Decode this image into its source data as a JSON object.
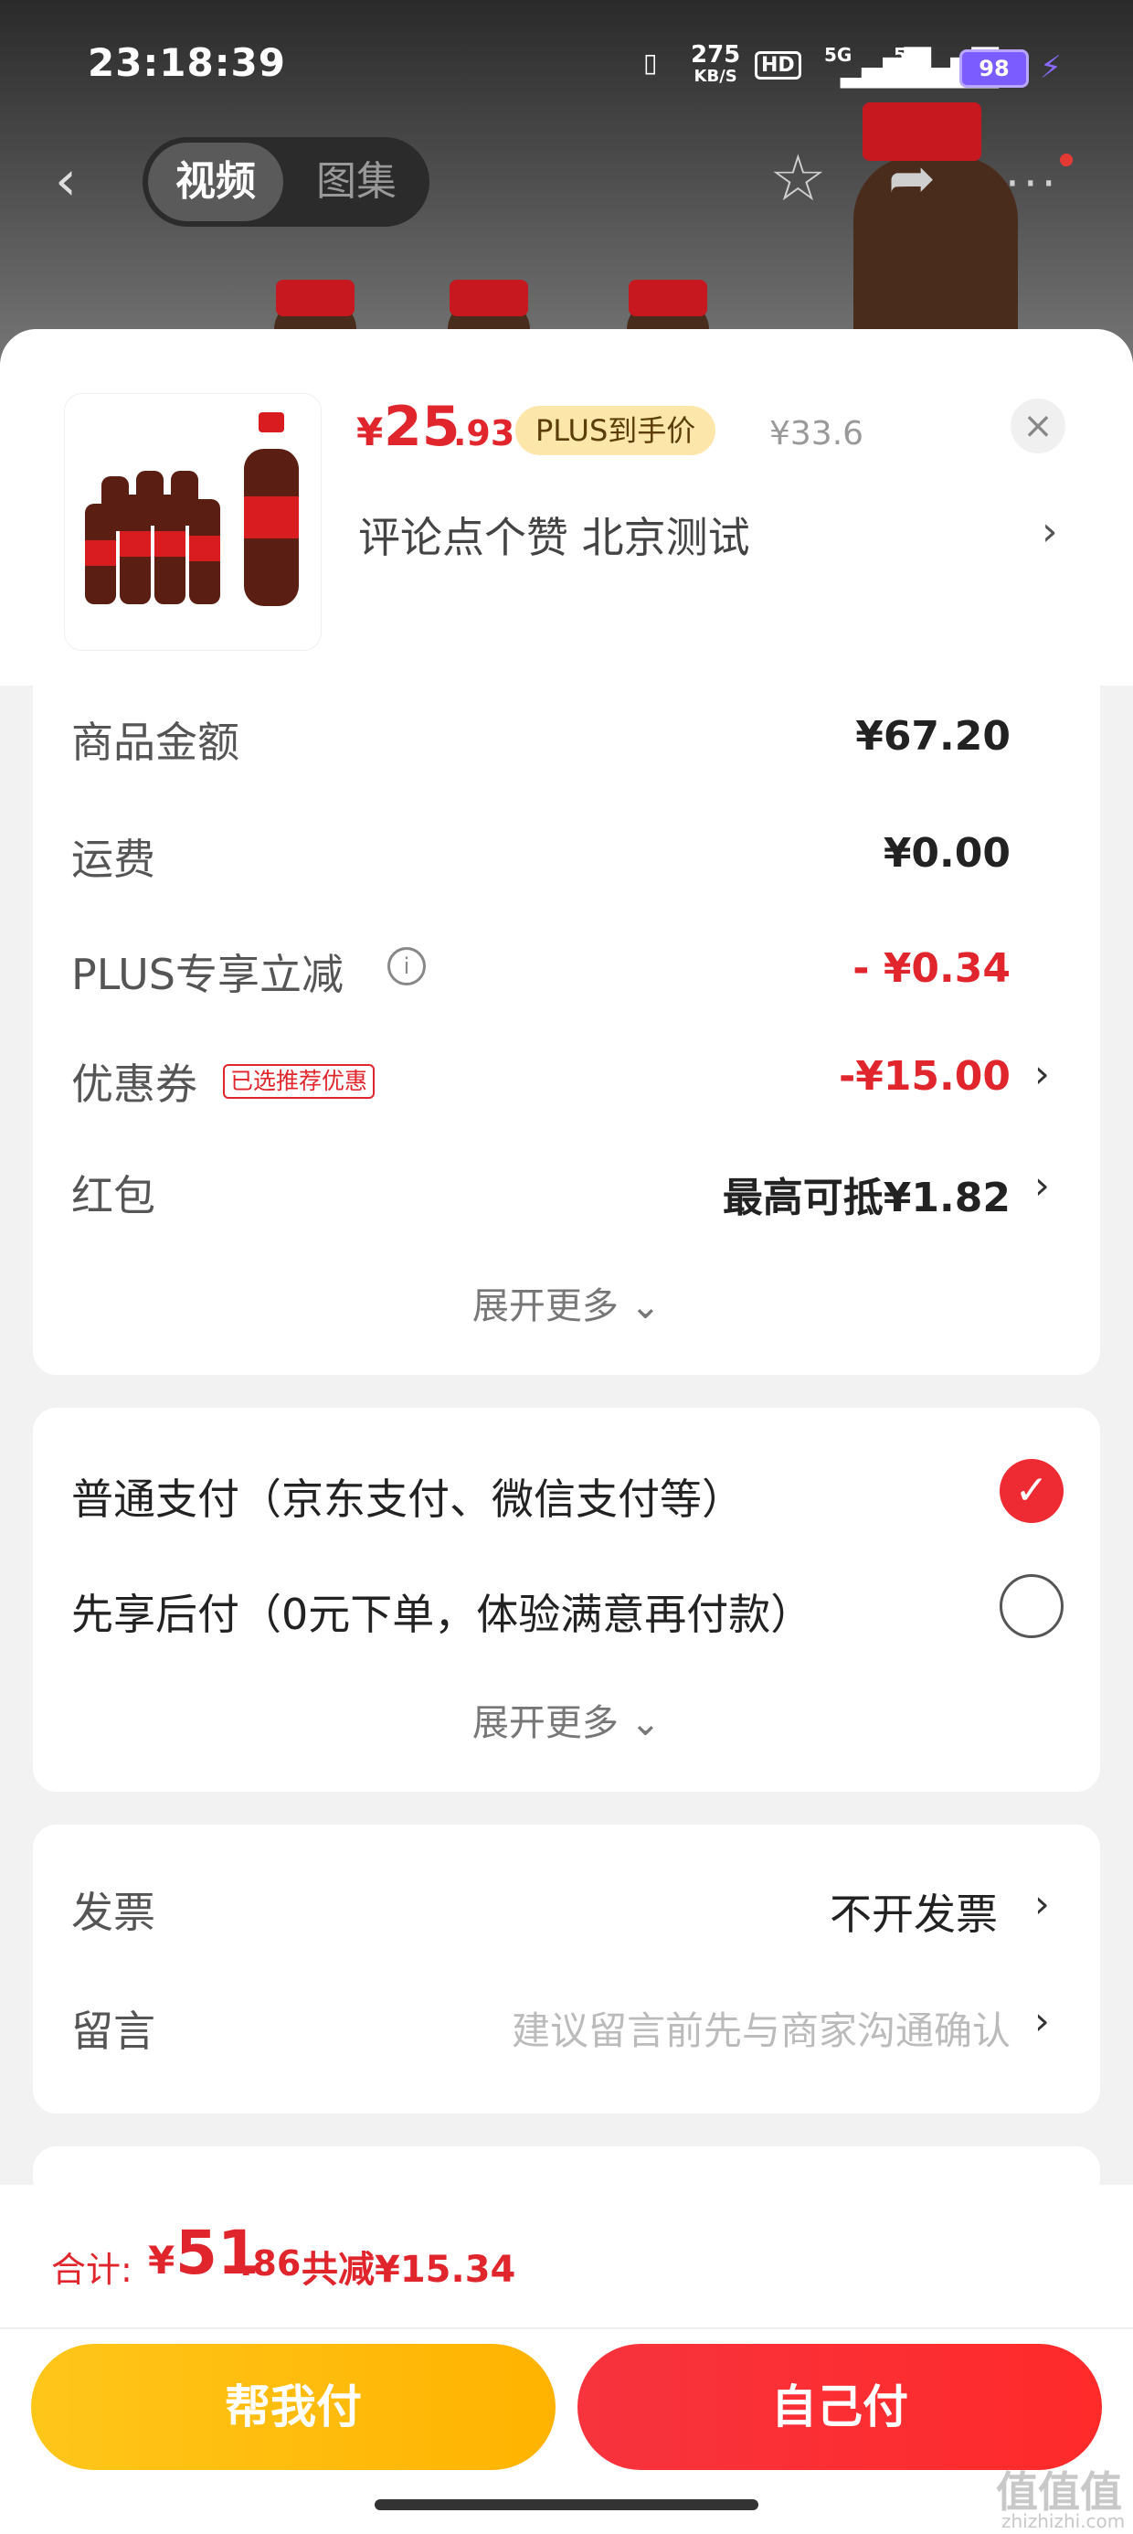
{
  "status_bar": {
    "time": "23:18:39",
    "net_speed_value": "275",
    "net_speed_unit": "KB/S",
    "hd": "HD",
    "signal1": "5G",
    "signal2": "5G",
    "battery": "98",
    "icons": [
      "vibrate-icon",
      "hd-icon",
      "signal-icon",
      "signal-icon",
      "battery-icon",
      "charging-icon"
    ]
  },
  "media_nav": {
    "tabs": [
      "视频",
      "图集"
    ],
    "active_tab": "视频",
    "icons": [
      "back-icon",
      "star-icon",
      "share-icon",
      "more-icon"
    ]
  },
  "product": {
    "price_currency": "¥",
    "price_main": "25",
    "price_decimal": ".93",
    "plus_badge": "PLUS到手价",
    "original_price": "¥33.6",
    "title": "评论点个赞  北京测试",
    "chevron": "›",
    "close": "×"
  },
  "summary": {
    "rows": [
      {
        "label": "商品金额",
        "value": "¥67.20"
      },
      {
        "label": "运费",
        "value": "¥0.00"
      },
      {
        "label": "PLUS专享立减",
        "value": "- ¥0.34"
      },
      {
        "label": "优惠券",
        "tag": "已选推荐优惠",
        "value": "-¥15.00"
      },
      {
        "label": "红包",
        "value": "最高可抵¥1.82"
      }
    ],
    "expand": "展开更多 ⌄"
  },
  "payment": {
    "options": [
      {
        "label": "普通支付（京东支付、微信支付等）",
        "selected": true
      },
      {
        "label": "先享后付（0元下单，体验满意再付款）",
        "selected": false
      }
    ],
    "expand": "展开更多 ⌄"
  },
  "extras": {
    "invoice_label": "发票",
    "invoice_value": "不开发票",
    "note_label": "留言",
    "note_placeholder": "建议留言前先与商家沟通确认"
  },
  "footer": {
    "total_label": "合计:",
    "total_currency": "¥",
    "total_main": "51",
    "total_decimal": ".86",
    "saving": "共减¥15.34",
    "help_pay": "帮我付",
    "self_pay": "自己付"
  },
  "watermark": {
    "text": "值值值",
    "sub": "zhizhizhi.com"
  },
  "colors": {
    "accent_red": "#e0262c",
    "help_pay_yellow": "#ffc61a",
    "self_pay_red": "#f7333d"
  }
}
